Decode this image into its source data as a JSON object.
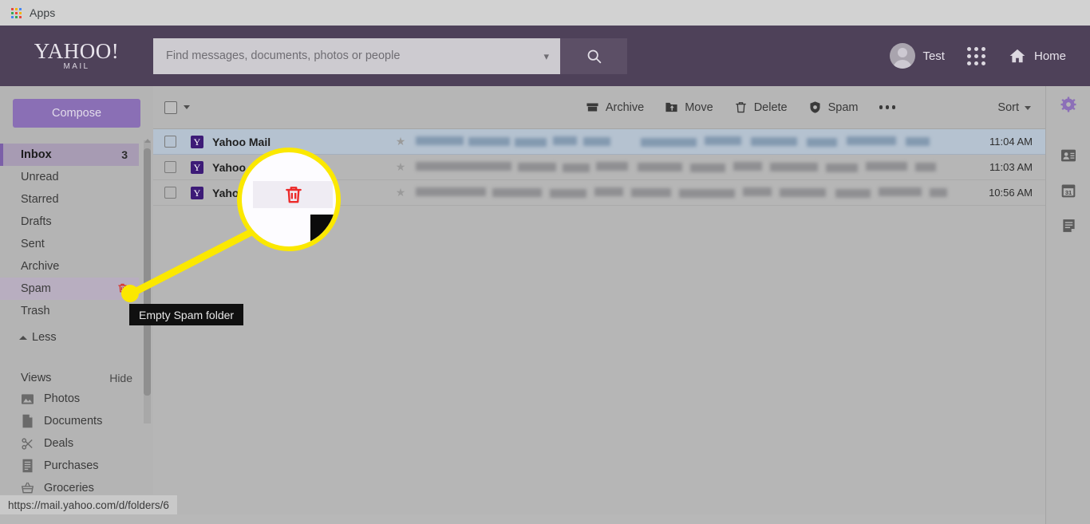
{
  "browser": {
    "apps_label": "Apps",
    "status_url": "https://mail.yahoo.com/d/folders/6",
    "apps_grid_colors": [
      "#e8453c",
      "#f5b400",
      "#4285f4",
      "#34a853",
      "#e8453c",
      "#f5b400",
      "#4285f4",
      "#34a853",
      "#e8453c"
    ]
  },
  "header": {
    "logo_main": "YAHOO!",
    "logo_sub": "MAIL",
    "search_placeholder": "Find messages, documents, photos or people",
    "search_value": "",
    "search_chevron_icon": "chevron-down-icon",
    "search_button_icon": "search-icon",
    "user_name": "Test",
    "apps_grid_icon": "apps-grid-icon",
    "home_label": "Home",
    "home_icon": "home-icon",
    "bg_color": "#4e4159"
  },
  "sidebar": {
    "compose_label": "Compose",
    "folders": [
      {
        "name": "Inbox",
        "count": "3",
        "state": "active"
      },
      {
        "name": "Unread",
        "count": "",
        "state": ""
      },
      {
        "name": "Starred",
        "count": "",
        "state": ""
      },
      {
        "name": "Drafts",
        "count": "",
        "state": ""
      },
      {
        "name": "Sent",
        "count": "",
        "state": ""
      },
      {
        "name": "Archive",
        "count": "",
        "state": ""
      },
      {
        "name": "Spam",
        "count": "",
        "state": "hover",
        "action_icon": "trash-icon",
        "action_color": "#d9352c"
      },
      {
        "name": "Trash",
        "count": "",
        "state": ""
      }
    ],
    "less_label": "Less",
    "less_icon": "chevron-up-icon",
    "views_title": "Views",
    "views_hide_label": "Hide",
    "views": [
      {
        "label": "Photos",
        "icon": "photo-icon"
      },
      {
        "label": "Documents",
        "icon": "document-icon"
      },
      {
        "label": "Deals",
        "icon": "scissors-icon"
      },
      {
        "label": "Purchases",
        "icon": "receipt-icon"
      },
      {
        "label": "Groceries",
        "icon": "basket-icon"
      }
    ]
  },
  "toolbar": {
    "select_all_icon": "checkbox-icon",
    "select_all_chevron": "chevron-down-icon",
    "actions": [
      {
        "label": "Archive",
        "icon": "archive-icon"
      },
      {
        "label": "Move",
        "icon": "move-folder-icon"
      },
      {
        "label": "Delete",
        "icon": "trash-icon"
      },
      {
        "label": "Spam",
        "icon": "spam-shield-icon"
      }
    ],
    "more_icon": "more-horizontal-icon",
    "sort_label": "Sort",
    "sort_chevron": "chevron-down-icon"
  },
  "messages": [
    {
      "sender": "Yahoo Mail",
      "time": "11:04 AM",
      "selected": true,
      "starred": false,
      "redacted": true
    },
    {
      "sender": "Yahoo",
      "time": "11:03 AM",
      "selected": false,
      "starred": false,
      "redacted": true
    },
    {
      "sender": "Yahoo",
      "time": "10:56 AM",
      "selected": false,
      "starred": false,
      "redacted": true
    }
  ],
  "right_rail": [
    {
      "icon": "gear-icon",
      "color": "#8c6fb8"
    },
    {
      "icon": "contacts-icon",
      "color": "#5b5b5b"
    },
    {
      "icon": "calendar-icon",
      "color": "#5b5b5b",
      "day": "31"
    },
    {
      "icon": "notepad-icon",
      "color": "#5b5b5b"
    }
  ],
  "callout": {
    "tooltip_text": "Empty Spam folder",
    "magnifier_icon": "trash-icon",
    "highlight_color": "#fbe800"
  }
}
